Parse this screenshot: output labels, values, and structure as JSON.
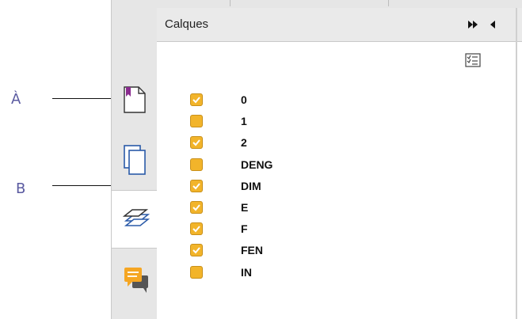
{
  "callouts": [
    {
      "label": "À"
    },
    {
      "label": "B"
    }
  ],
  "panel": {
    "title": "Calques",
    "header_buttons": [
      {
        "icon": "fast-forward-icon"
      },
      {
        "icon": "collapse-left-icon"
      }
    ],
    "options_icon": "layer-options-icon"
  },
  "side_tabs": [
    {
      "icon": "page-bookmark-icon",
      "active": false
    },
    {
      "icon": "pages-icon",
      "active": false
    },
    {
      "icon": "layers-icon",
      "active": true
    },
    {
      "icon": "comments-icon",
      "active": false
    }
  ],
  "layers": [
    {
      "name": "0",
      "visible": true
    },
    {
      "name": "1",
      "visible": false
    },
    {
      "name": "2",
      "visible": true
    },
    {
      "name": "DENG",
      "visible": false
    },
    {
      "name": "DIM",
      "visible": true
    },
    {
      "name": "E",
      "visible": true
    },
    {
      "name": "F",
      "visible": true
    },
    {
      "name": "FEN",
      "visible": true
    },
    {
      "name": "IN",
      "visible": false
    }
  ],
  "colors": {
    "checkbox": "#f2b42a",
    "accent_purple": "#8a2b8f",
    "callout_text": "#5a5aa0",
    "panel_bg": "#ffffff",
    "chrome_bg": "#e6e6e6"
  }
}
